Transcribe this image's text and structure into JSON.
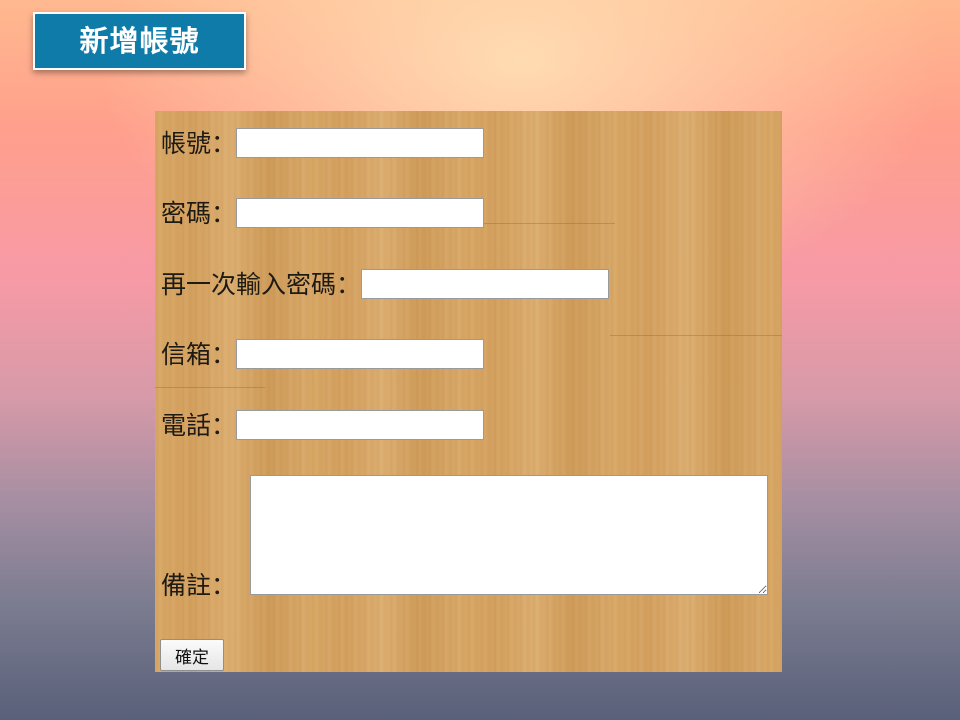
{
  "header": {
    "title": "新增帳號"
  },
  "form": {
    "fields": [
      {
        "label": "帳號：",
        "value": "",
        "placeholder": ""
      },
      {
        "label": "密碼：",
        "value": "",
        "placeholder": ""
      },
      {
        "label": "再一次輸入密碼：",
        "value": "",
        "placeholder": ""
      },
      {
        "label": "信箱：",
        "value": "",
        "placeholder": ""
      },
      {
        "label": "電話：",
        "value": "",
        "placeholder": ""
      }
    ],
    "note": {
      "label": "備註：",
      "value": "",
      "placeholder": ""
    },
    "submit_label": "確定"
  },
  "colors": {
    "title_background": "#0f7ba8",
    "panel_wood": "#d6a463"
  }
}
